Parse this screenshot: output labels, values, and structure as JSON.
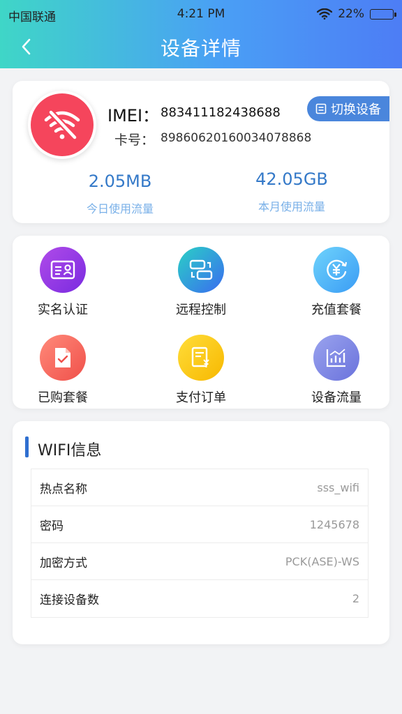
{
  "status_bar": {
    "carrier": "中国联通",
    "time": "4:21 PM",
    "battery": "22%",
    "battery_level": 0.22
  },
  "nav": {
    "title": "设备详情",
    "back_icon": "chevron-left-icon"
  },
  "device": {
    "avatar_icon": "wifi-off-icon",
    "avatar_color": "#f5455c",
    "imei_label": "IMEI：",
    "imei_value": "883411182438688",
    "card_label": "卡号：",
    "card_value": "89860620160034078868",
    "switch_label": "切换设备",
    "switch_icon": "switch-device-icon",
    "today_value": "2.05MB",
    "today_label": "今日使用流量",
    "month_value": "42.05GB",
    "month_label": "本月使用流量"
  },
  "menu": {
    "items": [
      {
        "label": "实名认证",
        "icon": "id-card-icon",
        "color_from": "#b04be9",
        "color_to": "#7a2be0"
      },
      {
        "label": "远程控制",
        "icon": "remote-control-icon",
        "color_from": "#2ad0c5",
        "color_to": "#3a6cf0"
      },
      {
        "label": "充值套餐",
        "icon": "recharge-icon",
        "color_from": "#6fd3fb",
        "color_to": "#3a9cf5"
      },
      {
        "label": "已购套餐",
        "icon": "purchased-package-icon",
        "color_from": "#ff8a7a",
        "color_to": "#f0504a"
      },
      {
        "label": "支付订单",
        "icon": "payment-order-icon",
        "color_from": "#ffdd3a",
        "color_to": "#f7b800"
      },
      {
        "label": "设备流量",
        "icon": "traffic-chart-icon",
        "color_from": "#9aa3ee",
        "color_to": "#6a72dc"
      }
    ]
  },
  "wifi": {
    "title": "WIFI信息",
    "rows": [
      {
        "key": "热点名称",
        "value": "sss_wifi"
      },
      {
        "key": "密码",
        "value": "1245678"
      },
      {
        "key": "加密方式",
        "value": "PCK(ASE)-WS"
      },
      {
        "key": "连接设备数",
        "value": "2"
      }
    ]
  },
  "colors": {
    "accent": "#3479c8",
    "header_gradient_start": "#3fd6c7",
    "header_gradient_end": "#4d7df5"
  }
}
